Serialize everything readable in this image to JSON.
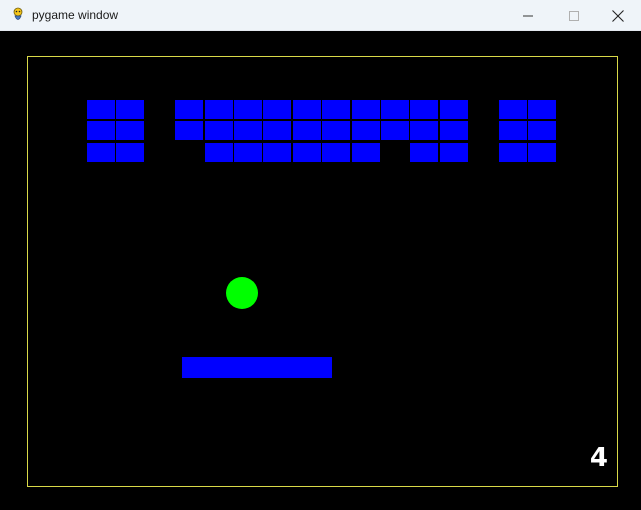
{
  "window": {
    "title": "pygame window",
    "app_icon": "pygame-snake-icon",
    "controls": [
      "minimize-icon",
      "maximize-icon",
      "close-icon"
    ]
  },
  "game": {
    "score": "4",
    "colors": {
      "background": "#000000",
      "border": "#ffff55",
      "brick": "#0000ff",
      "ball": "#00ff00",
      "paddle": "#0000ff",
      "score_text": "#ffffff"
    },
    "bricks": {
      "rows": [
        [
          1,
          1,
          0,
          1,
          1,
          1,
          1,
          1,
          1,
          1,
          1,
          1,
          1,
          0,
          1,
          1
        ],
        [
          1,
          1,
          0,
          1,
          1,
          1,
          1,
          1,
          1,
          1,
          1,
          1,
          1,
          0,
          1,
          1
        ],
        [
          1,
          1,
          0,
          0,
          1,
          1,
          1,
          1,
          1,
          1,
          0,
          1,
          1,
          0,
          1,
          1
        ]
      ]
    }
  }
}
